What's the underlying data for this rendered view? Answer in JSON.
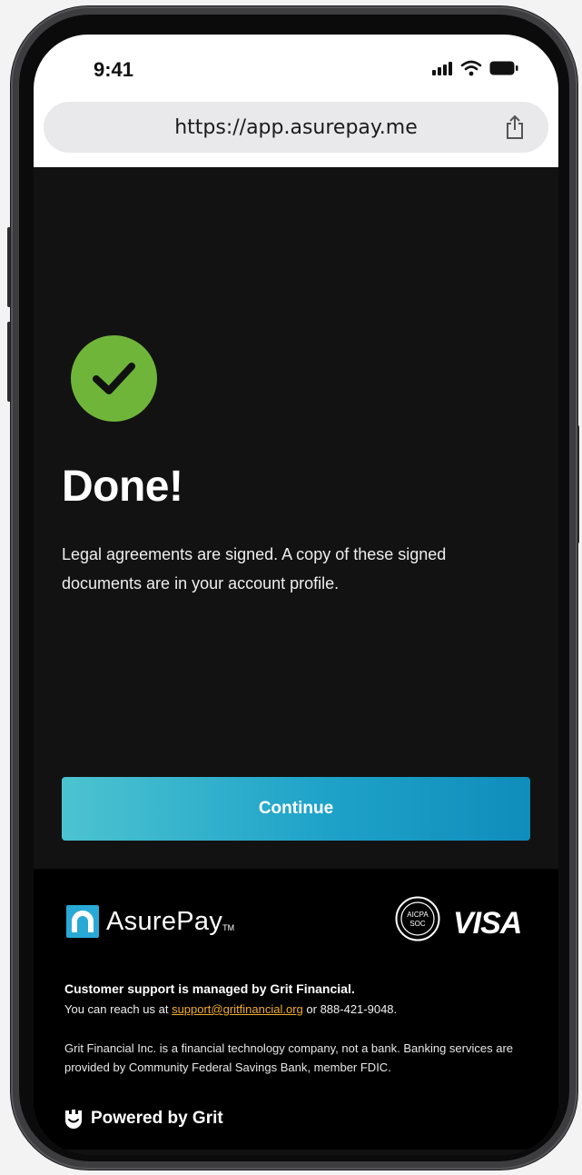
{
  "status_bar": {
    "time": "9:41",
    "icons": [
      "signal-bars-icon",
      "wifi-icon",
      "battery-icon"
    ]
  },
  "browser": {
    "url": "https://app.asurepay.me",
    "share_icon": "share-icon"
  },
  "main": {
    "status_icon": "check-circle-icon",
    "title": "Done!",
    "description": "Legal agreements are signed. A copy of these signed documents are in your account profile.",
    "continue_label": "Continue"
  },
  "footer": {
    "brand_name": "AsurePay",
    "brand_tm": "TM",
    "soc_badge_line1": "AICPA",
    "soc_badge_line2": "SOC",
    "card_network": "VISA",
    "support_title": "Customer support is managed by Grit Financial.",
    "support_prefix": "You can reach us at",
    "support_email": "support@gritfinancial.org",
    "support_suffix": "or 888-421-9048.",
    "disclaimer": "Grit Financial Inc. is a financial technology company, not a bank. Banking services are provided by Community Federal Savings Bank, member FDIC.",
    "powered_by": "Powered by Grit"
  },
  "colors": {
    "accent_gradient_start": "#4cc3d0",
    "accent_gradient_end": "#0f8dbb",
    "success_green": "#6fb53a",
    "link_orange": "#f0ad2a",
    "background_dark": "#121213"
  }
}
